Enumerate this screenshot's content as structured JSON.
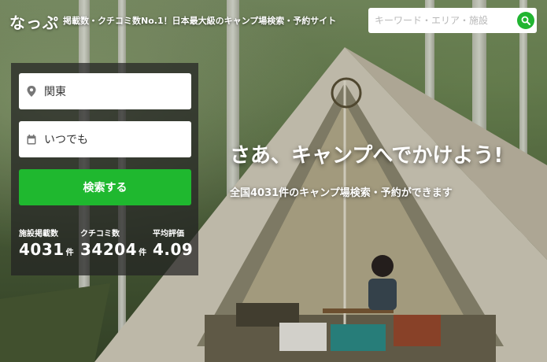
{
  "header": {
    "logo": "なっぷ",
    "tagline": "掲載数・クチコミ数No.1！日本最大級のキャンプ場検索・予約サイト",
    "search_placeholder": "キーワード・エリア・施設"
  },
  "search_panel": {
    "area_value": "関東",
    "date_value": "いつでも",
    "submit_label": "検索する"
  },
  "stats": [
    {
      "label": "施設掲載数",
      "value": "4031",
      "unit": "件"
    },
    {
      "label": "クチコミ数",
      "value": "34204",
      "unit": "件"
    },
    {
      "label": "平均評価",
      "value": "4.09",
      "unit": ""
    }
  ],
  "hero": {
    "title": "さあ、キャンプへでかけよう!",
    "subtitle": "全国4031件のキャンプ場検索・予約ができます"
  },
  "colors": {
    "accent_green": "#1fb82f",
    "panel_bg": "#232323"
  },
  "icons": [
    "location-pin-icon",
    "calendar-icon",
    "search-icon"
  ]
}
